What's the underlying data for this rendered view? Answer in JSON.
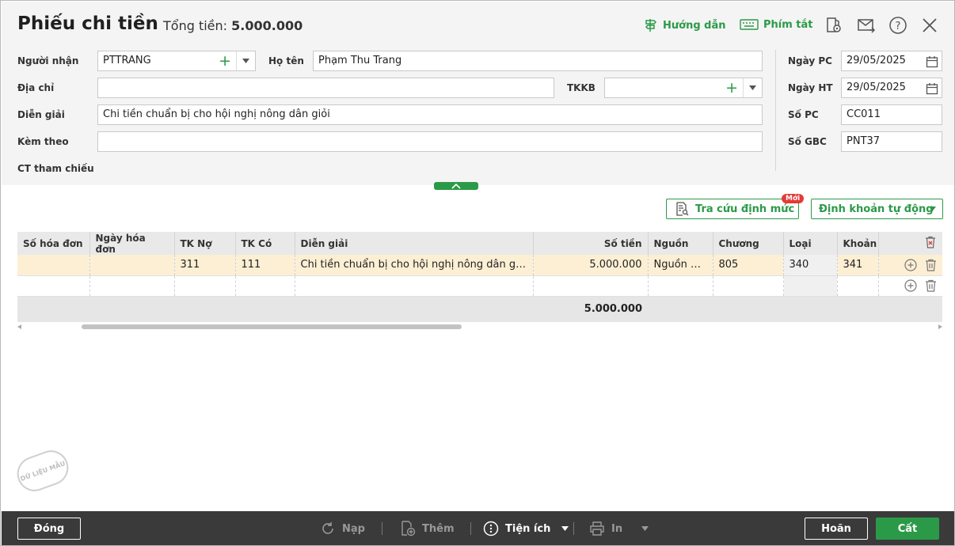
{
  "header": {
    "title": "Phiếu chi tiền",
    "total_label": "Tổng tiền:",
    "total_value": "5.000.000",
    "guide": "Hướng dẫn",
    "shortcuts": "Phím tắt"
  },
  "form": {
    "recipient_label": "Người nhận",
    "recipient_value": "PTTRANG",
    "name_label": "Họ tên",
    "name_value": "Phạm Thu Trang",
    "address_label": "Địa chỉ",
    "address_value": "",
    "tkkb_label": "TKKB",
    "tkkb_value": "",
    "desc_label": "Diễn giải",
    "desc_value": "Chi tiền chuẩn bị cho hội nghị nông dân giỏi",
    "attach_label": "Kèm theo",
    "attach_value": "",
    "ref_label": "CT tham chiếu",
    "date_pc_label": "Ngày PC",
    "date_pc_value": "29/05/2025",
    "date_ht_label": "Ngày HT",
    "date_ht_value": "29/05/2025",
    "so_pc_label": "Số PC",
    "so_pc_value": "CC011",
    "so_gbc_label": "Số GBC",
    "so_gbc_value": "PNT37"
  },
  "actions": {
    "lookup": "Tra cứu định mức",
    "new_badge": "Mới",
    "auto": "Định khoản tự động"
  },
  "table": {
    "columns": [
      "Số hóa đơn",
      "Ngày hóa đơn",
      "TK Nợ",
      "TK Có",
      "Diễn giải",
      "Số tiền",
      "Nguồn",
      "Chương",
      "Loại",
      "Khoản"
    ],
    "rows": [
      [
        "",
        "",
        "311",
        "111",
        "Chi tiền chuẩn bị cho hội nghị nông dân giỏi",
        "5.000.000",
        "Nguồn n...",
        "805",
        "340",
        "341"
      ]
    ],
    "sum": "5.000.000"
  },
  "stamp": "DỮ LIỆU MẪU",
  "footer": {
    "close": "Đóng",
    "reload": "Nạp",
    "add": "Thêm",
    "utility": "Tiện ích",
    "print": "In",
    "cancel": "Hoãn",
    "save": "Cất"
  },
  "colors": {
    "accent": "#2b9a48",
    "footer_bg": "#3a3a3a",
    "selected_row": "#fcefd4"
  }
}
